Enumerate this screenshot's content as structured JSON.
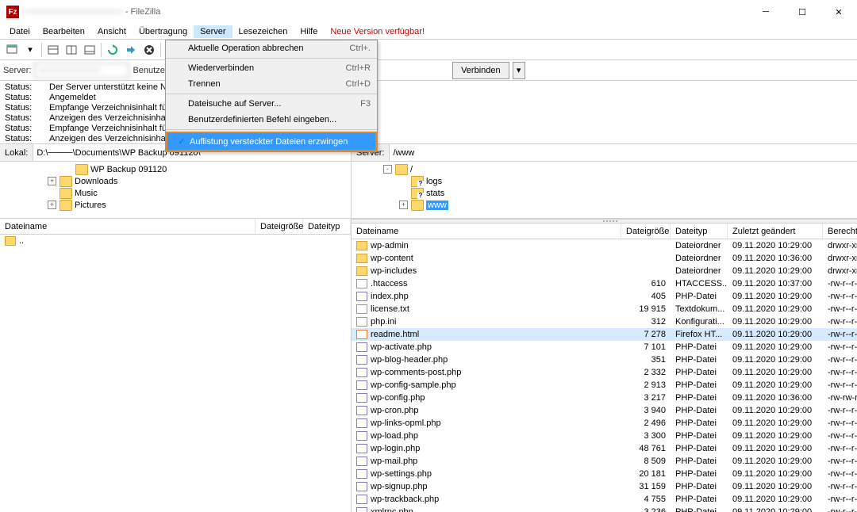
{
  "title": {
    "host": "────────────────",
    "app": " - FileZilla"
  },
  "menubar": [
    "Datei",
    "Bearbeiten",
    "Ansicht",
    "Übertragung",
    "Server",
    "Lesezeichen",
    "Hilfe",
    "Neue Version verfügbar!"
  ],
  "server_menu": [
    {
      "label": "Aktuelle Operation abbrechen",
      "shortcut": "Ctrl+.",
      "check": false
    },
    {
      "sep": true
    },
    {
      "label": "Wiederverbinden",
      "shortcut": "Ctrl+R",
      "check": false
    },
    {
      "label": "Trennen",
      "shortcut": "Ctrl+D",
      "check": false
    },
    {
      "sep": true
    },
    {
      "label": "Dateisuche auf Server...",
      "shortcut": "F3",
      "check": false
    },
    {
      "label": "Benutzerdefinierten Befehl eingeben...",
      "shortcut": "",
      "check": false
    },
    {
      "sep": true
    },
    {
      "label": "Auflistung versteckter Dateien erzwingen",
      "shortcut": "",
      "check": true,
      "hl": true
    }
  ],
  "quickconnect": {
    "server_label": "Server:",
    "server_value": "──────────",
    "user_label": "Benutzername:",
    "connect": "Verbinden"
  },
  "log": [
    {
      "label": "Status:",
      "msg": "Der Server unterstützt keine Nicht-"
    },
    {
      "label": "Status:",
      "msg": "Angemeldet"
    },
    {
      "label": "Status:",
      "msg": "Empfange Verzeichnisinhalt für \"/v"
    },
    {
      "label": "Status:",
      "msg": "Anzeigen des Verzeichnisinhalts für"
    },
    {
      "label": "Status:",
      "msg": "Empfange Verzeichnisinhalt für \"/v"
    },
    {
      "label": "Status:",
      "msg": "Anzeigen des Verzeichnisinhalts für"
    }
  ],
  "local": {
    "label": "Lokal:",
    "path": "D:\\────\\Documents\\WP Backup 091120\\",
    "tree": [
      {
        "depth": 2,
        "exp": "",
        "icon": "folder",
        "label": "WP Backup 091120"
      },
      {
        "depth": 1,
        "exp": "+",
        "icon": "folder",
        "label": "Downloads"
      },
      {
        "depth": 1,
        "exp": "",
        "icon": "music",
        "label": "Music"
      },
      {
        "depth": 1,
        "exp": "+",
        "icon": "pic",
        "label": "Pictures"
      }
    ],
    "cols": [
      "Dateiname",
      "Dateigröße",
      "Dateityp"
    ],
    "rows": [
      {
        "name": "..",
        "icon": "folder"
      }
    ]
  },
  "remote": {
    "label": "Server:",
    "path": "/www",
    "tree": [
      {
        "depth": 0,
        "exp": "-",
        "icon": "folder",
        "label": "/"
      },
      {
        "depth": 1,
        "exp": "",
        "icon": "folderq",
        "label": "logs"
      },
      {
        "depth": 1,
        "exp": "",
        "icon": "folderq",
        "label": "stats"
      },
      {
        "depth": 1,
        "exp": "+",
        "icon": "folder",
        "label": "www",
        "sel": true
      }
    ],
    "cols": [
      "Dateiname",
      "Dateigröße",
      "Dateityp",
      "Zuletzt geändert",
      "Berechtigu"
    ],
    "rows": [
      {
        "name": "wp-admin",
        "size": "",
        "type": "Dateiordner",
        "mod": "09.11.2020 10:29:00",
        "perm": "drwxr-xr-x",
        "icon": "folder"
      },
      {
        "name": "wp-content",
        "size": "",
        "type": "Dateiordner",
        "mod": "09.11.2020 10:36:00",
        "perm": "drwxr-xr-x",
        "icon": "folder"
      },
      {
        "name": "wp-includes",
        "size": "",
        "type": "Dateiordner",
        "mod": "09.11.2020 10:29:00",
        "perm": "drwxr-xr-x",
        "icon": "folder"
      },
      {
        "name": ".htaccess",
        "size": "610",
        "type": "HTACCESS...",
        "mod": "09.11.2020 10:37:00",
        "perm": "-rw-r--r--",
        "icon": "file"
      },
      {
        "name": "index.php",
        "size": "405",
        "type": "PHP-Datei",
        "mod": "09.11.2020 10:29:00",
        "perm": "-rw-r--r--",
        "icon": "php"
      },
      {
        "name": "license.txt",
        "size": "19 915",
        "type": "Textdokum...",
        "mod": "09.11.2020 10:29:00",
        "perm": "-rw-r--r--",
        "icon": "txt"
      },
      {
        "name": "php.ini",
        "size": "312",
        "type": "Konfigurati...",
        "mod": "09.11.2020 10:29:00",
        "perm": "-rw-r--r--",
        "icon": "file"
      },
      {
        "name": "readme.html",
        "size": "7 278",
        "type": "Firefox HT...",
        "mod": "09.11.2020 10:29:00",
        "perm": "-rw-r--r--",
        "icon": "html",
        "sel": true
      },
      {
        "name": "wp-activate.php",
        "size": "7 101",
        "type": "PHP-Datei",
        "mod": "09.11.2020 10:29:00",
        "perm": "-rw-r--r--",
        "icon": "php"
      },
      {
        "name": "wp-blog-header.php",
        "size": "351",
        "type": "PHP-Datei",
        "mod": "09.11.2020 10:29:00",
        "perm": "-rw-r--r--",
        "icon": "php"
      },
      {
        "name": "wp-comments-post.php",
        "size": "2 332",
        "type": "PHP-Datei",
        "mod": "09.11.2020 10:29:00",
        "perm": "-rw-r--r--",
        "icon": "php"
      },
      {
        "name": "wp-config-sample.php",
        "size": "2 913",
        "type": "PHP-Datei",
        "mod": "09.11.2020 10:29:00",
        "perm": "-rw-r--r--",
        "icon": "php"
      },
      {
        "name": "wp-config.php",
        "size": "3 217",
        "type": "PHP-Datei",
        "mod": "09.11.2020 10:36:00",
        "perm": "-rw-rw-rw",
        "icon": "php"
      },
      {
        "name": "wp-cron.php",
        "size": "3 940",
        "type": "PHP-Datei",
        "mod": "09.11.2020 10:29:00",
        "perm": "-rw-r--r--",
        "icon": "php"
      },
      {
        "name": "wp-links-opml.php",
        "size": "2 496",
        "type": "PHP-Datei",
        "mod": "09.11.2020 10:29:00",
        "perm": "-rw-r--r--",
        "icon": "php"
      },
      {
        "name": "wp-load.php",
        "size": "3 300",
        "type": "PHP-Datei",
        "mod": "09.11.2020 10:29:00",
        "perm": "-rw-r--r--",
        "icon": "php"
      },
      {
        "name": "wp-login.php",
        "size": "48 761",
        "type": "PHP-Datei",
        "mod": "09.11.2020 10:29:00",
        "perm": "-rw-r--r--",
        "icon": "php"
      },
      {
        "name": "wp-mail.php",
        "size": "8 509",
        "type": "PHP-Datei",
        "mod": "09.11.2020 10:29:00",
        "perm": "-rw-r--r--",
        "icon": "php"
      },
      {
        "name": "wp-settings.php",
        "size": "20 181",
        "type": "PHP-Datei",
        "mod": "09.11.2020 10:29:00",
        "perm": "-rw-r--r--",
        "icon": "php"
      },
      {
        "name": "wp-signup.php",
        "size": "31 159",
        "type": "PHP-Datei",
        "mod": "09.11.2020 10:29:00",
        "perm": "-rw-r--r--",
        "icon": "php"
      },
      {
        "name": "wp-trackback.php",
        "size": "4 755",
        "type": "PHP-Datei",
        "mod": "09.11.2020 10:29:00",
        "perm": "-rw-r--r--",
        "icon": "php"
      },
      {
        "name": "xmlrpc.php",
        "size": "3 236",
        "type": "PHP-Datei",
        "mod": "09.11.2020 10:29:00",
        "perm": "-rw-r--r--",
        "icon": "php"
      }
    ]
  }
}
